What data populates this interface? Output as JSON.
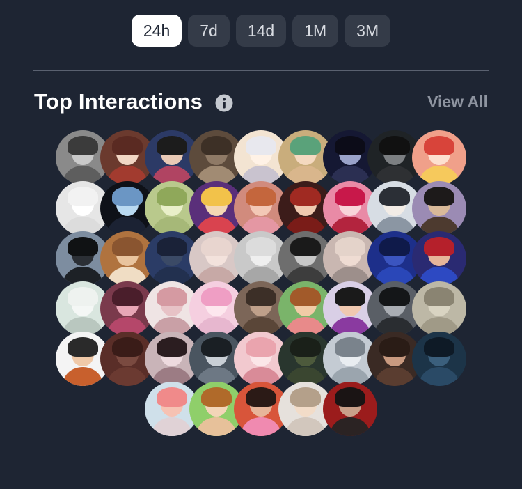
{
  "range_tabs": [
    {
      "label": "24h",
      "active": true
    },
    {
      "label": "7d",
      "active": false
    },
    {
      "label": "14d",
      "active": false
    },
    {
      "label": "1M",
      "active": false
    },
    {
      "label": "3M",
      "active": false
    }
  ],
  "section": {
    "title": "Top Interactions",
    "info_icon": "info-icon",
    "view_all_label": "View All"
  },
  "avatars": [
    {
      "bg": "#8a8a8a",
      "face": "#c9c9c9",
      "hair": "#3b3b3b",
      "body": "#5e5e5e"
    },
    {
      "bg": "#6b3a2e",
      "face": "#f1d6c4",
      "hair": "#5a2a22",
      "body": "#a23b2f"
    },
    {
      "bg": "#2c3a66",
      "face": "#e9c9b5",
      "hair": "#1c1c1c",
      "body": "#b04462"
    },
    {
      "bg": "#5d4b3c",
      "face": "#8f7a66",
      "hair": "#3d3026",
      "body": "#a18b73"
    },
    {
      "bg": "#f3e4d2",
      "face": "#fff2e6",
      "hair": "#e8e8ee",
      "body": "#c9c3cf"
    },
    {
      "bg": "#c9ad7c",
      "face": "#f4d9c0",
      "hair": "#5aa27a",
      "body": "#d9b68c"
    },
    {
      "bg": "#151833",
      "face": "#9aa3c9",
      "hair": "#0c0c18",
      "body": "#2b2f52"
    },
    {
      "bg": "#1f2326",
      "face": "#7c7f82",
      "hair": "#111111",
      "body": "#2e3033"
    },
    {
      "bg": "#f0a08a",
      "face": "#fde0d0",
      "hair": "#d8443a",
      "body": "#f6c95c"
    },
    {
      "bg": "#e6e6e6",
      "face": "#ffffff",
      "hair": "#f2f2f2",
      "body": "#dcdcdc"
    },
    {
      "bg": "#0e1118",
      "face": "#b9d9f1",
      "hair": "#6b96c4",
      "body": "#1b2233"
    },
    {
      "bg": "#b9c98c",
      "face": "#e9efc9",
      "hair": "#8fa85a",
      "body": "#a6b878"
    },
    {
      "bg": "#5a2f7a",
      "face": "#f4d7b4",
      "hair": "#f2c24a",
      "body": "#d9434f"
    },
    {
      "bg": "#d18b7d",
      "face": "#f3c8b6",
      "hair": "#c4663d",
      "body": "#e497a3"
    },
    {
      "bg": "#3c1c1a",
      "face": "#f0c9b0",
      "hair": "#a02a22",
      "body": "#7a1c18"
    },
    {
      "bg": "#e98aa6",
      "face": "#f8d4d9",
      "hair": "#c8184a",
      "body": "#b3243e"
    },
    {
      "bg": "#d7dde4",
      "face": "#f2ece6",
      "hair": "#2b2f36",
      "body": "#8b96a3"
    },
    {
      "bg": "#9b8bb4",
      "face": "#d9b999",
      "hair": "#1d1a1a",
      "body": "#4d3a2f"
    },
    {
      "bg": "#7d8da0",
      "face": "#2b2f35",
      "hair": "#101214",
      "body": "#1d2126"
    },
    {
      "bg": "#b0733f",
      "face": "#e9c49e",
      "hair": "#8a5530",
      "body": "#f0ddc4"
    },
    {
      "bg": "#2b3c66",
      "face": "#3b4a66",
      "hair": "#1a2238",
      "body": "#22304f"
    },
    {
      "bg": "#d8c8c6",
      "face": "#f3e2dc",
      "hair": "#e8d5cf",
      "body": "#c7a9a6"
    },
    {
      "bg": "#c9c9c9",
      "face": "#efefef",
      "hair": "#dcdcdc",
      "body": "#a7a7a7"
    },
    {
      "bg": "#6e6e6e",
      "face": "#c7c7c7",
      "hair": "#1a1a1a",
      "body": "#3d3d3d"
    },
    {
      "bg": "#c9b7b1",
      "face": "#efdcd3",
      "hair": "#e4d3ca",
      "body": "#9d8f8b"
    },
    {
      "bg": "#1d2f8a",
      "face": "#3b55c0",
      "hair": "#0f1a4a",
      "body": "#2a47b8"
    },
    {
      "bg": "#2a2a72",
      "face": "#e6b59a",
      "hair": "#b5202b",
      "body": "#2d49c2"
    },
    {
      "bg": "#d9e6df",
      "face": "#f4f7f5",
      "hair": "#eef2ef",
      "body": "#b9c7bf"
    },
    {
      "bg": "#7a3a4c",
      "face": "#e8a6b6",
      "hair": "#4a1e2b",
      "body": "#b5476a"
    },
    {
      "bg": "#efe4e4",
      "face": "#e7c2c6",
      "hair": "#d59aa2",
      "body": "#c9a0a6"
    },
    {
      "bg": "#f5cfe0",
      "face": "#fde7ee",
      "hair": "#ef9ec4",
      "body": "#e7b7cf"
    },
    {
      "bg": "#7c6658",
      "face": "#bfa08a",
      "hair": "#3c2f27",
      "body": "#5a4638"
    },
    {
      "bg": "#7ab46a",
      "face": "#f1cba6",
      "hair": "#a25a2a",
      "body": "#e88a8a"
    },
    {
      "bg": "#d9cfe6",
      "face": "#f0c9b0",
      "hair": "#1a1a1a",
      "body": "#8a3aa0"
    },
    {
      "bg": "#5a5f66",
      "face": "#a9adb3",
      "hair": "#141618",
      "body": "#2a2d31"
    },
    {
      "bg": "#bdb8a6",
      "face": "#d9d4c2",
      "hair": "#8a8472",
      "body": "#a09a87"
    },
    {
      "bg": "#f4f4f4",
      "face": "#f0c9a8",
      "hair": "#2a2a2a",
      "body": "#c8602d"
    },
    {
      "bg": "#5a2e28",
      "face": "#7a4a40",
      "hair": "#3a1c18",
      "body": "#6b3a31"
    },
    {
      "bg": "#c9b4b8",
      "face": "#eddade",
      "hair": "#2b1d20",
      "body": "#9c7c84"
    },
    {
      "bg": "#4a5560",
      "face": "#c9cfd6",
      "hair": "#1a1f24",
      "body": "#6d7884"
    },
    {
      "bg": "#f2c9cf",
      "face": "#fbe6e8",
      "hair": "#eaa4ae",
      "body": "#d98b98"
    },
    {
      "bg": "#29362e",
      "face": "#4d5a3c",
      "hair": "#1a2019",
      "body": "#3a4630"
    },
    {
      "bg": "#c4cbd3",
      "face": "#e9edf1",
      "hair": "#7a838c",
      "body": "#9ba5ae"
    },
    {
      "bg": "#3a2a24",
      "face": "#c99a80",
      "hair": "#2a1c16",
      "body": "#5a3d30"
    },
    {
      "bg": "#1c3448",
      "face": "#3b5f7c",
      "hair": "#0e1a26",
      "body": "#2a4a66"
    },
    {
      "bg": "#cfe0ea",
      "face": "#f6c2b3",
      "hair": "#f08a8a",
      "body": "#e0d2d6"
    },
    {
      "bg": "#8fcf6a",
      "face": "#f3d5b8",
      "hair": "#b06a2a",
      "body": "#e7c19a"
    },
    {
      "bg": "#d8553a",
      "face": "#e7b59a",
      "hair": "#2b1a16",
      "body": "#f08ab0"
    },
    {
      "bg": "#e6e1dc",
      "face": "#f2dcc8",
      "hair": "#b4a08a",
      "body": "#d2c7bd"
    },
    {
      "bg": "#9b1c1c",
      "face": "#c9a08a",
      "hair": "#1a1414",
      "body": "#2b2323"
    }
  ]
}
